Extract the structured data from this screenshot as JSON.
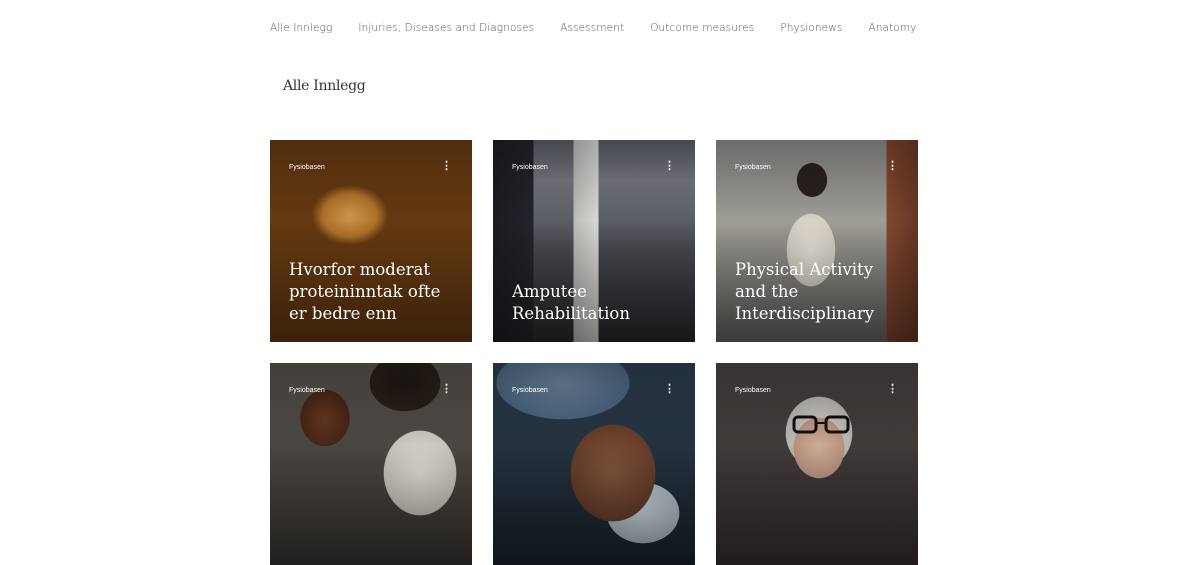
{
  "nav": {
    "items": [
      {
        "label": "Alle Innlegg"
      },
      {
        "label": "Injuries, Diseases and Diagnoses"
      },
      {
        "label": "Assessment"
      },
      {
        "label": "Outcome measures"
      },
      {
        "label": "Physionews"
      },
      {
        "label": "Anatomy"
      }
    ]
  },
  "section": {
    "title": "Alle Innlegg"
  },
  "posts": [
    {
      "author": "Fysiobasen",
      "more": "⋮",
      "title": "Hvorfor moderat proteininntak ofte er bedre enn «mest…"
    },
    {
      "author": "Fysiobasen",
      "more": "⋮",
      "title": "Amputee Rehabilitation"
    },
    {
      "author": "Fysiobasen",
      "more": "⋮",
      "title": "Physical Activity and the Interdisciplinary Team"
    },
    {
      "author": "Fysiobasen",
      "more": "⋮",
      "title": ""
    },
    {
      "author": "Fysiobasen",
      "more": "⋮",
      "title": ""
    },
    {
      "author": "Fysiobasen",
      "more": "⋮",
      "title": ""
    }
  ]
}
